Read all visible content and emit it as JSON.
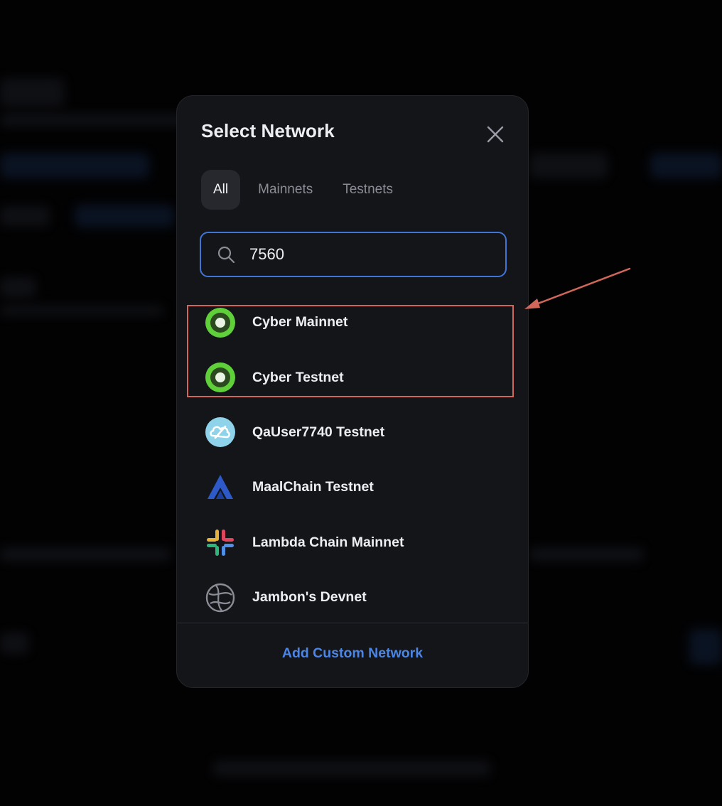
{
  "modal": {
    "title": "Select Network",
    "tabs": [
      {
        "label": "All",
        "active": true
      },
      {
        "label": "Mainnets",
        "active": false
      },
      {
        "label": "Testnets",
        "active": false
      }
    ],
    "search": {
      "value": "7560"
    },
    "networks": [
      {
        "label": "Cyber Mainnet",
        "icon": "cyber-logo-icon"
      },
      {
        "label": "Cyber Testnet",
        "icon": "cyber-logo-icon"
      },
      {
        "label": "QaUser7740 Testnet",
        "icon": "cloud-link-logo-icon"
      },
      {
        "label": "MaalChain Testnet",
        "icon": "maalchain-logo-icon"
      },
      {
        "label": "Lambda Chain Mainnet",
        "icon": "lambda-logo-icon"
      },
      {
        "label": "Jambon's Devnet",
        "icon": "globe-icon"
      }
    ],
    "add_custom_label": "Add Custom Network"
  },
  "colors": {
    "accent": "#3f76d6",
    "link": "#4b85e6",
    "annotation": "#d0675a",
    "modal_background": "#141519"
  }
}
